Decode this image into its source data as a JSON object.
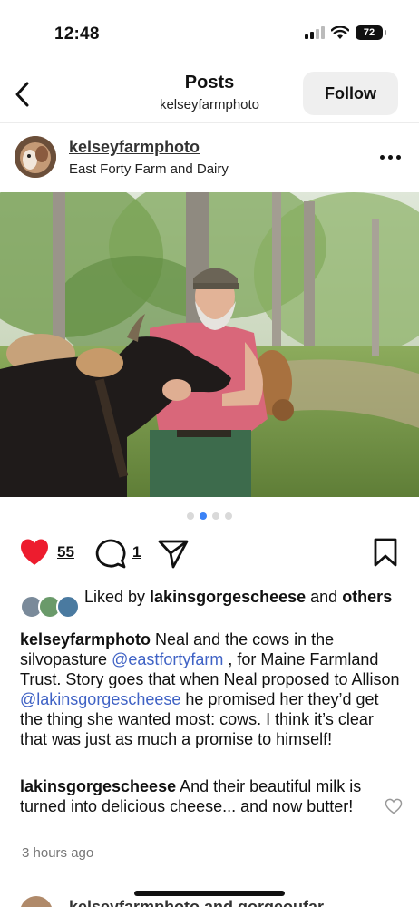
{
  "status_bar": {
    "time": "12:48",
    "battery": "72"
  },
  "header": {
    "title": "Posts",
    "subtitle": "kelseyfarmphoto",
    "follow_label": "Follow"
  },
  "post": {
    "username": "kelseyfarmphoto",
    "location": "East Forty Farm and Dairy",
    "carousel": {
      "count": 4,
      "active_index": 1
    },
    "likes": "55",
    "comments": "1",
    "liked_by": {
      "prefix": "Liked by ",
      "user": "lakinsgorgescheese",
      "middle": " and ",
      "others": "others"
    },
    "caption": {
      "username": "kelseyfarmphoto",
      "text_1": " Neal and the cows in the silvopasture ",
      "mention_1": "@eastfortyfarm",
      "text_2": " , for Maine Farmland Trust. Story goes that when Neal proposed to Allison ",
      "mention_2": "@lakinsgorgescheese",
      "text_3": " he promised her they’d get the thing she wanted most: cows. I think it’s clear that was just as much a promise to himself!"
    },
    "top_comment": {
      "username": "lakinsgorgescheese",
      "text": " And their beautiful milk is turned into delicious cheese... and now butter!"
    },
    "time_ago": "3 hours ago"
  },
  "next_post": {
    "username": "kelseyfarmphoto and gorgeoufar"
  },
  "icons": {
    "like": "heart-icon",
    "comment": "comment-bubble-icon",
    "share": "paper-plane-icon",
    "save": "bookmark-icon",
    "back": "chevron-left-icon",
    "more": "more-horizontal-icon"
  },
  "colors": {
    "like": "#ed1c2e",
    "mention": "#3f62c5",
    "active_dot": "#3b82f6",
    "follow_bg": "#efefef"
  }
}
